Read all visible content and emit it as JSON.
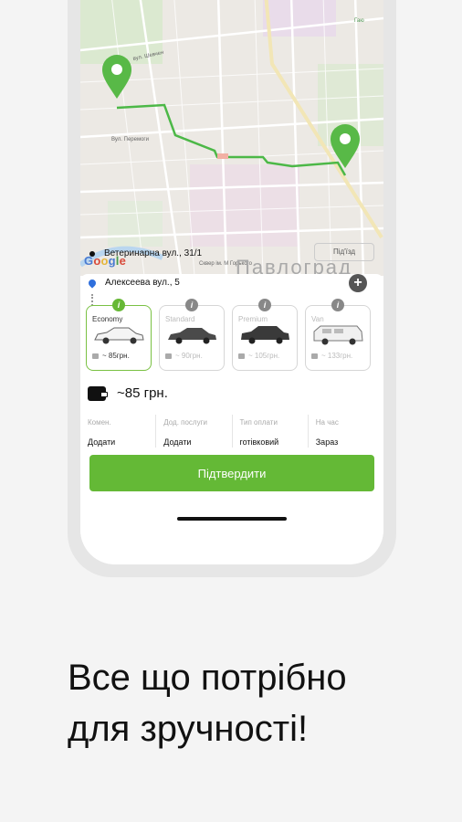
{
  "map": {
    "streets": [
      "вул. Шевчен",
      "Вул. Перемоги",
      "Сквер ім. М Горького",
      "Гаю"
    ],
    "city": "Павлоград",
    "attribution": "Google"
  },
  "route": {
    "from": "Ветеринарна вул., 31/1",
    "to": "Алексеева вул., 5",
    "entrance_label": "Під'їзд"
  },
  "cars": [
    {
      "name": "Economy",
      "price": "~ 85грн.",
      "selected": true
    },
    {
      "name": "Standard",
      "price": "~ 90грн.",
      "selected": false
    },
    {
      "name": "Premium",
      "price": "~ 105грн.",
      "selected": false
    },
    {
      "name": "Van",
      "price": "~ 133грн.",
      "selected": false
    }
  ],
  "total": "~85 грн.",
  "options": [
    {
      "label": "Комен.",
      "value": "Додати"
    },
    {
      "label": "Дод. послуги",
      "value": "Додати"
    },
    {
      "label": "Тип оплати",
      "value": "готівковий"
    },
    {
      "label": "На час",
      "value": "Зараз"
    }
  ],
  "confirm_label": "Підтвердити",
  "headline": [
    "Все що потрібно",
    "для зручності!"
  ],
  "colors": {
    "accent": "#64b936",
    "route": "#4cb847"
  }
}
